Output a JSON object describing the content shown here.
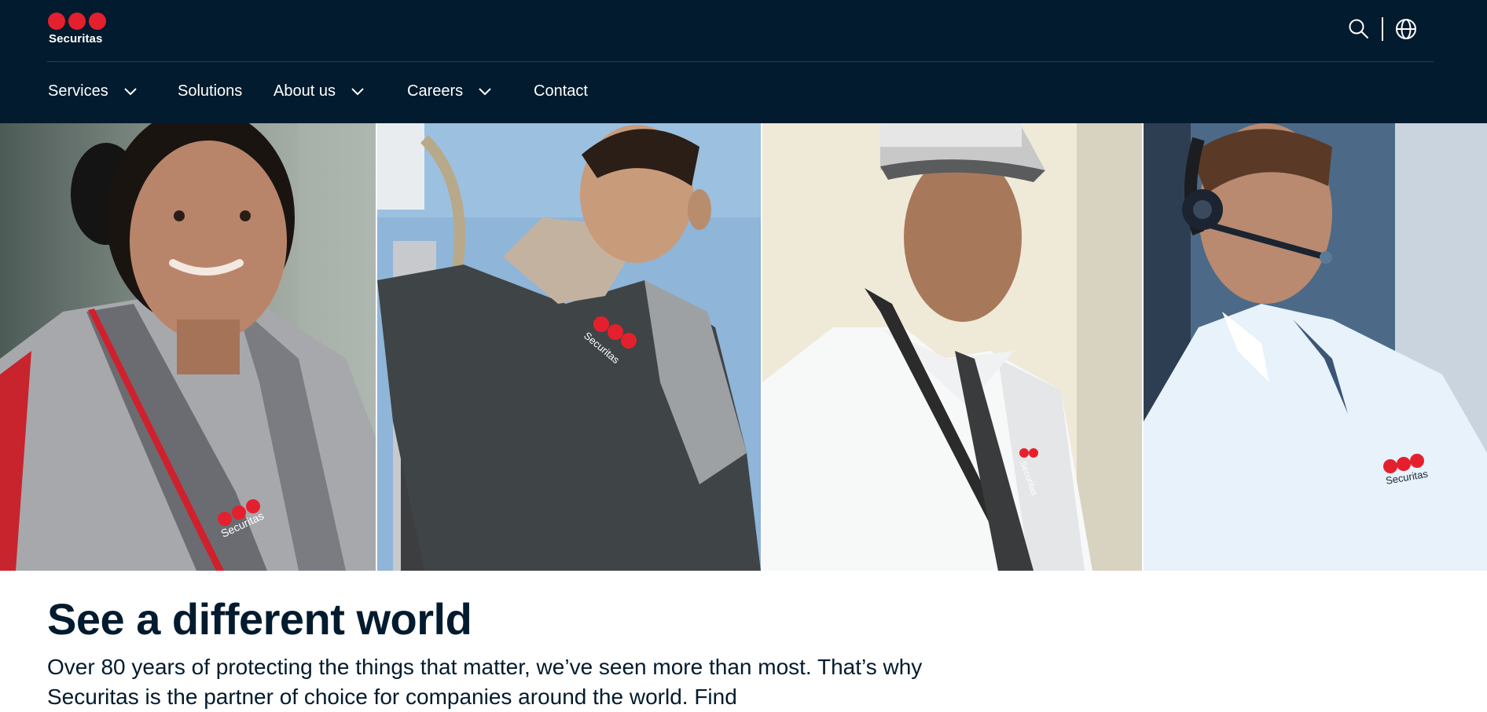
{
  "brand": {
    "name": "Securitas",
    "accent_color": "#e5202e",
    "header_color": "#031b2e"
  },
  "header": {
    "tools": [
      {
        "name": "search",
        "icon": "search-icon"
      },
      {
        "name": "language",
        "icon": "globe-icon"
      }
    ]
  },
  "nav": {
    "items": [
      {
        "label": "Services",
        "has_dropdown": true
      },
      {
        "label": "Solutions",
        "has_dropdown": false
      },
      {
        "label": "About us",
        "has_dropdown": true
      },
      {
        "label": "Careers",
        "has_dropdown": true
      },
      {
        "label": "Contact",
        "has_dropdown": false
      }
    ]
  },
  "hero": {
    "panels": [
      {
        "badge": "Securitas"
      },
      {
        "badge": "Securitas"
      },
      {
        "badge": "Securitas"
      },
      {
        "badge": "Securitas"
      }
    ]
  },
  "main": {
    "headline": "See a different world",
    "intro": "Over 80 years of protecting the things that matter, we’ve seen more than most. That’s why Securitas is the partner of choice for companies around the world. Find"
  }
}
